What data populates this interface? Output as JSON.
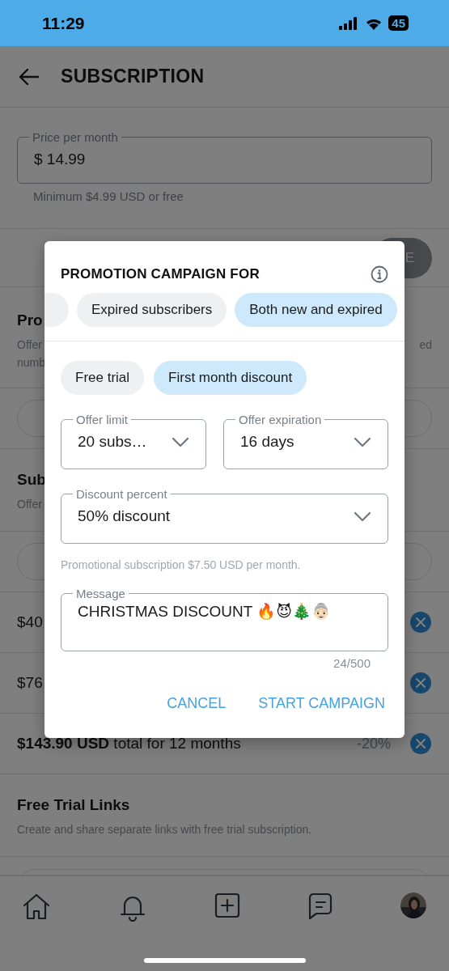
{
  "status_bar": {
    "time": "11:29",
    "battery": "45"
  },
  "header": {
    "title": "SUBSCRIPTION"
  },
  "price_field": {
    "label": "Price per month",
    "value": "$ 14.99",
    "helper": "Minimum $4.99 USD or free"
  },
  "save_button": {
    "label": "E"
  },
  "promotions_section": {
    "title": "Pro",
    "description_lines": [
      "Offer",
      "numb"
    ],
    "description_right": "ed"
  },
  "bundles_section": {
    "title": "Sub",
    "description": "Offer",
    "bundles": [
      {
        "text": "$40"
      },
      {
        "text": "$76"
      },
      {
        "text": "**$143.90 USD** total for 12 months",
        "discount": "-20%"
      }
    ]
  },
  "free_trial_links": {
    "title": "Free Trial Links",
    "description": "Create and share separate links with free trial subscription."
  },
  "dialog": {
    "title": "PROMOTION CAMPAIGN FOR",
    "audience_options": [
      {
        "label": "Expired subscribers",
        "selected": false
      },
      {
        "label": "Both new and expired",
        "selected": true
      }
    ],
    "offer_types": [
      {
        "label": "Free trial",
        "selected": false
      },
      {
        "label": "First month discount",
        "selected": true
      }
    ],
    "selects": [
      {
        "label": "Offer limit",
        "value": "20 subs…"
      },
      {
        "label": "Offer expiration",
        "value": "16 days"
      }
    ],
    "discount": {
      "label": "Discount percent",
      "value": "50% discount"
    },
    "helper": "Promotional subscription $7.50 USD per month.",
    "message": {
      "label": "Message",
      "value": "CHRISTMAS DISCOUNT 🔥😈🎄👵🏻",
      "counter": "24/500"
    },
    "buttons": [
      "CANCEL",
      "START CAMPAIGN"
    ]
  }
}
